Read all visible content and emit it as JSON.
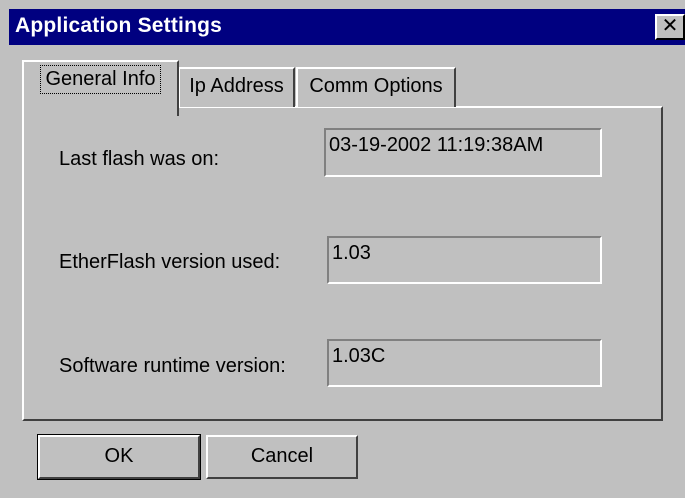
{
  "window": {
    "title": "Application Settings",
    "close_label": "✕"
  },
  "tabs": [
    {
      "label": "General Info",
      "active": true
    },
    {
      "label": "Ip Address",
      "active": false
    },
    {
      "label": "Comm Options",
      "active": false
    }
  ],
  "fields": [
    {
      "label": "Last flash was on:",
      "value": "03-19-2002 11:19:38AM"
    },
    {
      "label": "EtherFlash version used:",
      "value": "1.03"
    },
    {
      "label": "Software runtime version:",
      "value": "1.03C"
    }
  ],
  "buttons": {
    "ok_label": "OK",
    "cancel_label": "Cancel"
  }
}
